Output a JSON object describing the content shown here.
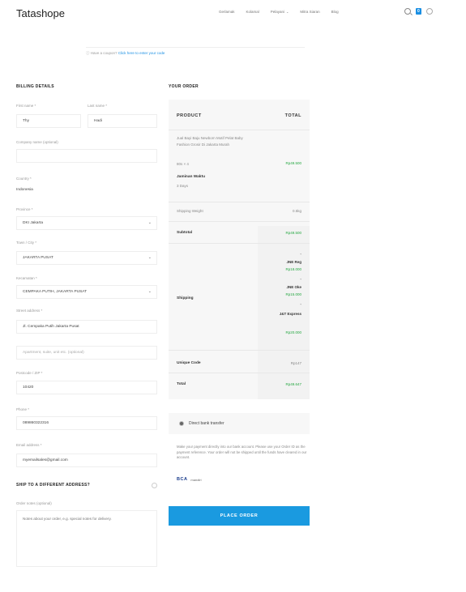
{
  "header": {
    "logo": "Tatashope",
    "nav": [
      "Gerlamak",
      "Kolamal",
      "Pelayani",
      "Mitra Siaran",
      "Blog"
    ],
    "nav_dropdown_index": 2,
    "cart_count": "0"
  },
  "coupon": {
    "text": "Have a coupon?",
    "link": "Click here to enter your code"
  },
  "billing": {
    "title": "BILLING DETAILS",
    "first_name_label": "First name *",
    "first_name_value": "Thy",
    "last_name_label": "Last name *",
    "last_name_value": "Hadi",
    "company_label": "Company name (optional)",
    "country_label": "Country *",
    "country_value": "Indonesia",
    "province_label": "Province *",
    "province_value": "DKI Jakarta",
    "city_label": "Town / City *",
    "city_value": "JAKARTA PUSAT",
    "district_label": "Kecamatan *",
    "district_value": "CEMPAKA PUTIH, JAKARTA PUSAT",
    "street_label": "Street address *",
    "street_value": "Jl. Cempaka Putih Jakarta Pusat",
    "street2_placeholder": "Apartment, suite, unit etc. (optional)",
    "postcode_label": "Postcode / ZIP *",
    "postcode_value": "10420",
    "phone_label": "Phone *",
    "phone_value": "089860322316",
    "email_label": "Email address *",
    "email_value": "myemailsales@gmail.com"
  },
  "shipping": {
    "title": "SHIP TO A DIFFERENT ADDRESS?",
    "notes_label": "Order notes (optional)",
    "notes_placeholder": "Notes about your order, e.g. special notes for delivery."
  },
  "order": {
    "title": "YOUR ORDER",
    "col_product": "PRODUCT",
    "col_total": "TOTAL",
    "item_name": "Jual Bayi Baju Newborn Motif Pelat Baby Fashion Grosir Di Jakarta Murah",
    "item_qty": "80s  × 4",
    "item_total": "Rp49.500",
    "weight_label": "Jaminan Waktu",
    "weight_sub": "3 Days",
    "shipping_weight_label": "Shipping Weight",
    "shipping_weight_value": "0.5kg",
    "subtotal_label": "Subtotal",
    "subtotal_value": "Rp49.500",
    "shipping_label": "Shipping",
    "shipping_options": [
      {
        "name": "JNE Reg",
        "price": "Rp18.000"
      },
      {
        "name": "JNE Oke",
        "price": "Rp15.000"
      },
      {
        "name": "J&T Express",
        "price": "Rp20.000"
      }
    ],
    "unique_label": "Unique Code",
    "unique_value": "Rp147",
    "total_label": "Total",
    "total_value": "Rp49.647"
  },
  "payment": {
    "method": "Direct bank transfer",
    "description": "Make your payment directly into our bank account. Please use your Order ID as the payment reference. Your order will not be shipped until the funds have cleared in our account.",
    "logo1": "BCA",
    "logo2": "mandiri",
    "button": "PLACE ORDER"
  },
  "colors": {
    "accent": "#1a9ae0",
    "price_green": "#27a843"
  }
}
